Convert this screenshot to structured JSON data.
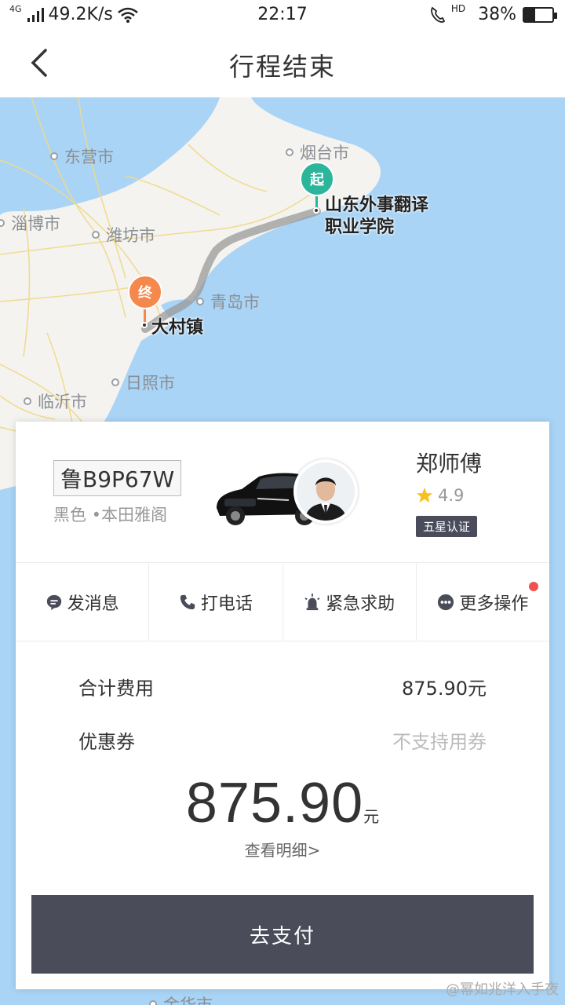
{
  "status_bar": {
    "network_type": "4G",
    "speed": "49.2K/s",
    "time": "22:17",
    "hd_label": "HD",
    "battery_percent_text": "38%",
    "battery_level": 0.38
  },
  "nav": {
    "title": "行程结束"
  },
  "map": {
    "cities": [
      "东营市",
      "烟台市",
      "淄博市",
      "潍坊市",
      "青岛市",
      "日照市",
      "临沂市",
      "金华市"
    ],
    "start_pin": "起",
    "end_pin": "终",
    "start_place": "山东外事翻译",
    "start_place_line2": "职业学院",
    "end_place": "大村镇",
    "start_color": "#2bb59b",
    "end_color": "#f5884c"
  },
  "driver": {
    "plate": "鲁B9P67W",
    "car_desc": "黑色 •本田雅阁",
    "name": "郑师傅",
    "rating": "4.9",
    "certification": "五星认证"
  },
  "actions": [
    {
      "label": "发消息",
      "icon": "message-icon"
    },
    {
      "label": "打电话",
      "icon": "phone-icon"
    },
    {
      "label": "紧急求助",
      "icon": "alarm-icon"
    },
    {
      "label": "更多操作",
      "icon": "more-icon"
    }
  ],
  "fees": {
    "total_label": "合计费用",
    "total_value": "875.90元",
    "coupon_label": "优惠券",
    "coupon_value": "不支持用券",
    "amount": "875.90",
    "unit": "元",
    "detail_link": "查看明细>"
  },
  "pay_button": "去支付",
  "watermark": "@幂如兆洋入手夜"
}
